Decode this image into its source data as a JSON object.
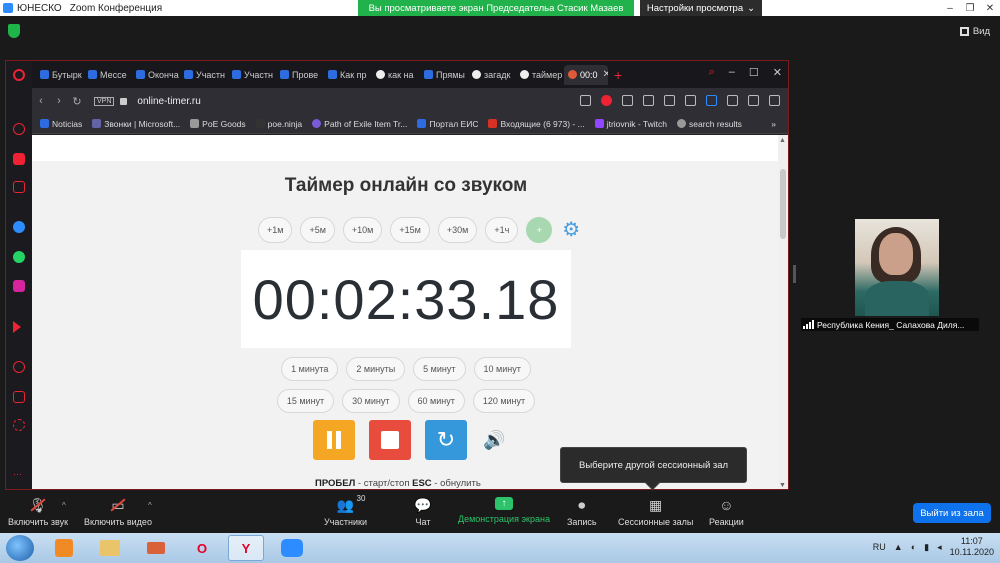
{
  "zoom_titlebar": {
    "app_name": "ЮНЕСКО",
    "window_title": "Zoom Конференция",
    "banner": "Вы просматриваете экран Председательа Стасик Мазаев",
    "view_options": "Настройки просмотра",
    "view_button": "Вид"
  },
  "browser": {
    "tabs": [
      {
        "label": "Бутырк",
        "color": "#2d6be0"
      },
      {
        "label": "Мессе",
        "color": "#2d6be0"
      },
      {
        "label": "Оконча",
        "color": "#2d6be0"
      },
      {
        "label": "Участн",
        "color": "#2d6be0"
      },
      {
        "label": "Участн",
        "color": "#2d6be0"
      },
      {
        "label": "Прове",
        "color": "#2d6be0"
      },
      {
        "label": "Как пр",
        "color": "#2d6be0"
      },
      {
        "label": "как на",
        "color": "#eeeeee"
      },
      {
        "label": "Прямы",
        "color": "#2d6be0"
      },
      {
        "label": "загадк",
        "color": "#eeeeee"
      },
      {
        "label": "таймер",
        "color": "#eeeeee"
      },
      {
        "label": "00:0",
        "color": "#e05a3a"
      }
    ],
    "url": "online-timer.ru",
    "vpn_label": "VPN",
    "bookmarks": [
      {
        "label": "Noticias",
        "color": "#2d6be0"
      },
      {
        "label": "Звонки | Microsoft...",
        "color": "#6264a7"
      },
      {
        "label": "PoE Goods",
        "color": "#999999"
      },
      {
        "label": "poe.ninja",
        "color": "#333333"
      },
      {
        "label": "Path of Exile Item Tr...",
        "color": "#7a5ad6"
      },
      {
        "label": "Портал ЕИС",
        "color": "#2d6be0"
      },
      {
        "label": "Входящие (6 973) - ...",
        "color": "#d93025"
      },
      {
        "label": "jtriovnik - Twitch",
        "color": "#9146ff"
      },
      {
        "label": "search results",
        "color": "#999999"
      }
    ],
    "bookmarks_more": "»"
  },
  "timer": {
    "title": "Таймер онлайн со звуком",
    "quick_add": [
      "+1м",
      "+5м",
      "+10м",
      "+15м",
      "+30м",
      "+1ч"
    ],
    "plus": "+",
    "display": "00:02:33.18",
    "presets": [
      "1 минута",
      "2 минуты",
      "5 минут",
      "10 минут",
      "15 минут",
      "30 минут",
      "60 минут",
      "120 минут"
    ],
    "hint_key1": "ПРОБЕЛ",
    "hint_text1": " - старт/стоп  ",
    "hint_key2": "ESC",
    "hint_text2": " - обнулить"
  },
  "popup": {
    "text": "Выберите другой сессионный зал"
  },
  "participant": {
    "name": "Республика Кения_ Салахова Диля..."
  },
  "toolbar": {
    "unmute": "Включить звук",
    "start_video": "Включить видео",
    "participants": "Участники",
    "participants_count": "30",
    "chat": "Чат",
    "share_screen": "Демонстрация экрана",
    "record": "Запись",
    "breakout_rooms": "Сессионные залы",
    "reactions": "Реакции",
    "leave": "Выйти из зала"
  },
  "taskbar": {
    "lang": "RU",
    "time": "11:07",
    "date": "10.11.2020"
  },
  "colors": {
    "zoom_green": "#22b24c",
    "pause": "#f5a623",
    "stop": "#e74c3c",
    "reset": "#3498db",
    "leave": "#0e72ed"
  }
}
